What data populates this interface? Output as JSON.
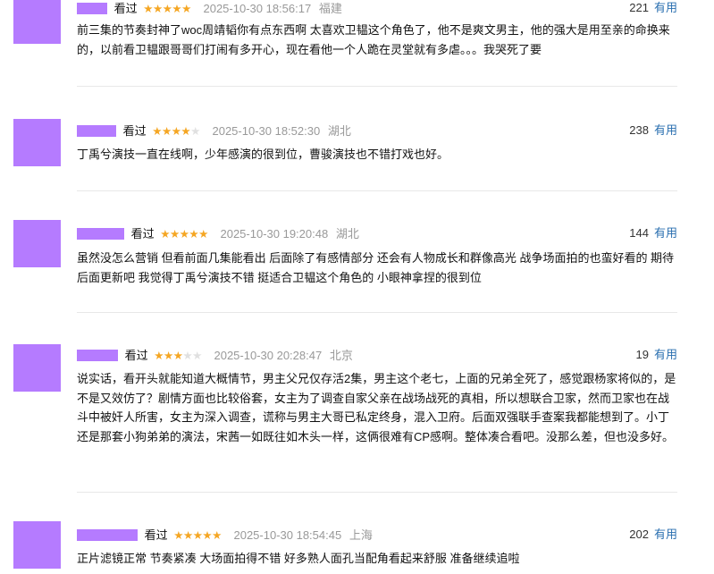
{
  "comments": [
    {
      "status": "看过",
      "rating": 5,
      "time": "2025-10-30 18:56:17",
      "location": "福建",
      "votes": "221",
      "useful_label": "有用",
      "text": "前三集的节奏封神了woc周靖韬你有点东西啊 太喜欢卫韫这个角色了，他不是爽文男主，他的强大是用至亲的命换来的，以前看卫韫跟哥哥们打闹有多开心，现在看他一个人跪在灵堂就有多虐。。。我哭死了要"
    },
    {
      "status": "看过",
      "rating": 4,
      "time": "2025-10-30 18:52:30",
      "location": "湖北",
      "votes": "238",
      "useful_label": "有用",
      "text": "丁禹兮演技一直在线啊，少年感演的很到位，曹骏演技也不错打戏也好。"
    },
    {
      "status": "看过",
      "rating": 5,
      "time": "2025-10-30 19:20:48",
      "location": "湖北",
      "votes": "144",
      "useful_label": "有用",
      "text": "虽然没怎么营销 但看前面几集能看出 后面除了有感情部分 还会有人物成长和群像高光 战争场面拍的也蛮好看的 期待后面更新吧 我觉得丁禹兮演技不错 挺适合卫韫这个角色的 小眼神拿捏的很到位"
    },
    {
      "status": "看过",
      "rating": 3,
      "time": "2025-10-30 20:28:47",
      "location": "北京",
      "votes": "19",
      "useful_label": "有用",
      "text": "说实话，看开头就能知道大概情节，男主父兄仅存活2集，男主这个老七，上面的兄弟全死了，感觉跟杨家将似的，是不是又效仿了？剧情方面也比较俗套，女主为了调查自家父亲在战场战死的真相，所以想联合卫家，然而卫家也在战斗中被奸人所害，女主为深入调查，谎称与男主大哥已私定终身，混入卫府。后面双强联手查案我都能想到了。小丁还是那套小狗弟弟的演法，宋茜一如既往如木头一样，这俩很难有CP感啊。整体凑合看吧。没那么差，但也没多好。"
    },
    {
      "status": "看过",
      "rating": 5,
      "time": "2025-10-30 18:54:45",
      "location": "上海",
      "votes": "202",
      "useful_label": "有用",
      "text": "正片滤镜正常 节奏紧凑 大场面拍得不错 好多熟人面孔当配角看起来舒服 准备继续追啦"
    }
  ]
}
